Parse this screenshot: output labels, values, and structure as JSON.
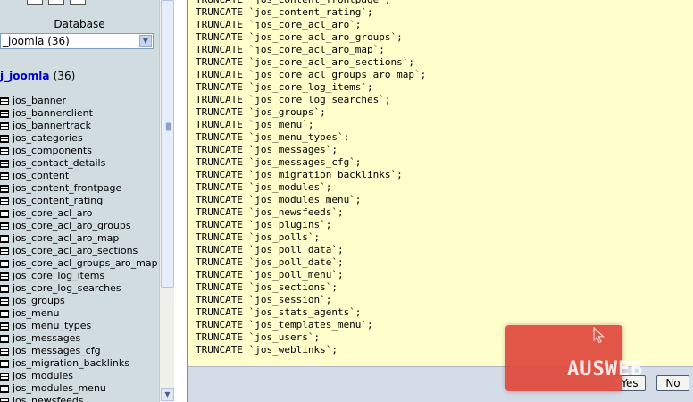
{
  "left_panel": {
    "database_label": "Database",
    "db_select_value": "_joomla (36)",
    "db_heading_name": "j_joomla",
    "db_heading_count": "(36)",
    "tables": [
      "jos_banner",
      "jos_bannerclient",
      "jos_bannertrack",
      "jos_categories",
      "jos_components",
      "jos_contact_details",
      "jos_content",
      "jos_content_frontpage",
      "jos_content_rating",
      "jos_core_acl_aro",
      "jos_core_acl_aro_groups",
      "jos_core_acl_aro_map",
      "jos_core_acl_aro_sections",
      "jos_core_acl_groups_aro_map",
      "jos_core_log_items",
      "jos_core_log_searches",
      "jos_groups",
      "jos_menu",
      "jos_menu_types",
      "jos_messages",
      "jos_messages_cfg",
      "jos_migration_backlinks",
      "jos_modules",
      "jos_modules_menu",
      "jos_newsfeeds"
    ]
  },
  "sql_lines": [
    "TRUNCATE `jos_content_frontpage`;",
    "TRUNCATE `jos_content_rating`;",
    "TRUNCATE `jos_core_acl_aro`;",
    "TRUNCATE `jos_core_acl_aro_groups`;",
    "TRUNCATE `jos_core_acl_aro_map`;",
    "TRUNCATE `jos_core_acl_aro_sections`;",
    "TRUNCATE `jos_core_acl_groups_aro_map`;",
    "TRUNCATE `jos_core_log_items`;",
    "TRUNCATE `jos_core_log_searches`;",
    "TRUNCATE `jos_groups`;",
    "TRUNCATE `jos_menu`;",
    "TRUNCATE `jos_menu_types`;",
    "TRUNCATE `jos_messages`;",
    "TRUNCATE `jos_messages_cfg`;",
    "TRUNCATE `jos_migration_backlinks`;",
    "TRUNCATE `jos_modules`;",
    "TRUNCATE `jos_modules_menu`;",
    "TRUNCATE `jos_newsfeeds`;",
    "TRUNCATE `jos_plugins`;",
    "TRUNCATE `jos_polls`;",
    "TRUNCATE `jos_poll_data`;",
    "TRUNCATE `jos_poll_date`;",
    "TRUNCATE `jos_poll_menu`;",
    "TRUNCATE `jos_sections`;",
    "TRUNCATE `jos_session`;",
    "TRUNCATE `jos_stats_agents`;",
    "TRUNCATE `jos_templates_menu`;",
    "TRUNCATE `jos_users`;",
    "TRUNCATE `jos_weblinks`;"
  ],
  "buttons": {
    "yes": "Yes",
    "no": "No"
  },
  "watermark": {
    "text": "AUSWEB",
    "color": "#e04a3e"
  },
  "icons": {
    "table": "table-icon",
    "dropdown": "chevron-down-icon",
    "cursor": "mouse-cursor-icon"
  }
}
